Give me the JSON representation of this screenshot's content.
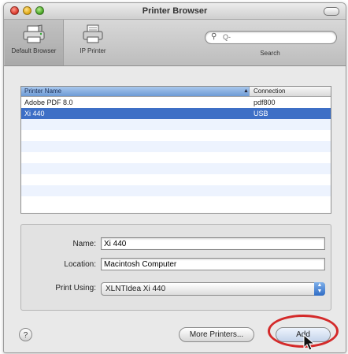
{
  "window": {
    "title": "Printer Browser"
  },
  "toolbar": {
    "default_browser_label": "Default Browser",
    "ip_printer_label": "IP Printer",
    "search_label": "Search",
    "search_placeholder": "Q-"
  },
  "printer_list": {
    "columns": [
      "Printer Name",
      "Connection"
    ],
    "rows": [
      {
        "name": "Adobe PDF 8.0",
        "connection": "pdf800"
      },
      {
        "name": "Xi 440",
        "connection": "USB"
      }
    ],
    "selected_index": 1
  },
  "details": {
    "name_label": "Name:",
    "name_value": "Xi 440",
    "location_label": "Location:",
    "location_value": "Macintosh Computer",
    "print_using_label": "Print Using:",
    "print_using_value": "XLNTIdea Xi 440"
  },
  "buttons": {
    "help": "?",
    "more_printers": "More Printers...",
    "add": "Add"
  },
  "colors": {
    "selection": "#3d6fc6",
    "annotation_ring": "#d42a2a"
  }
}
